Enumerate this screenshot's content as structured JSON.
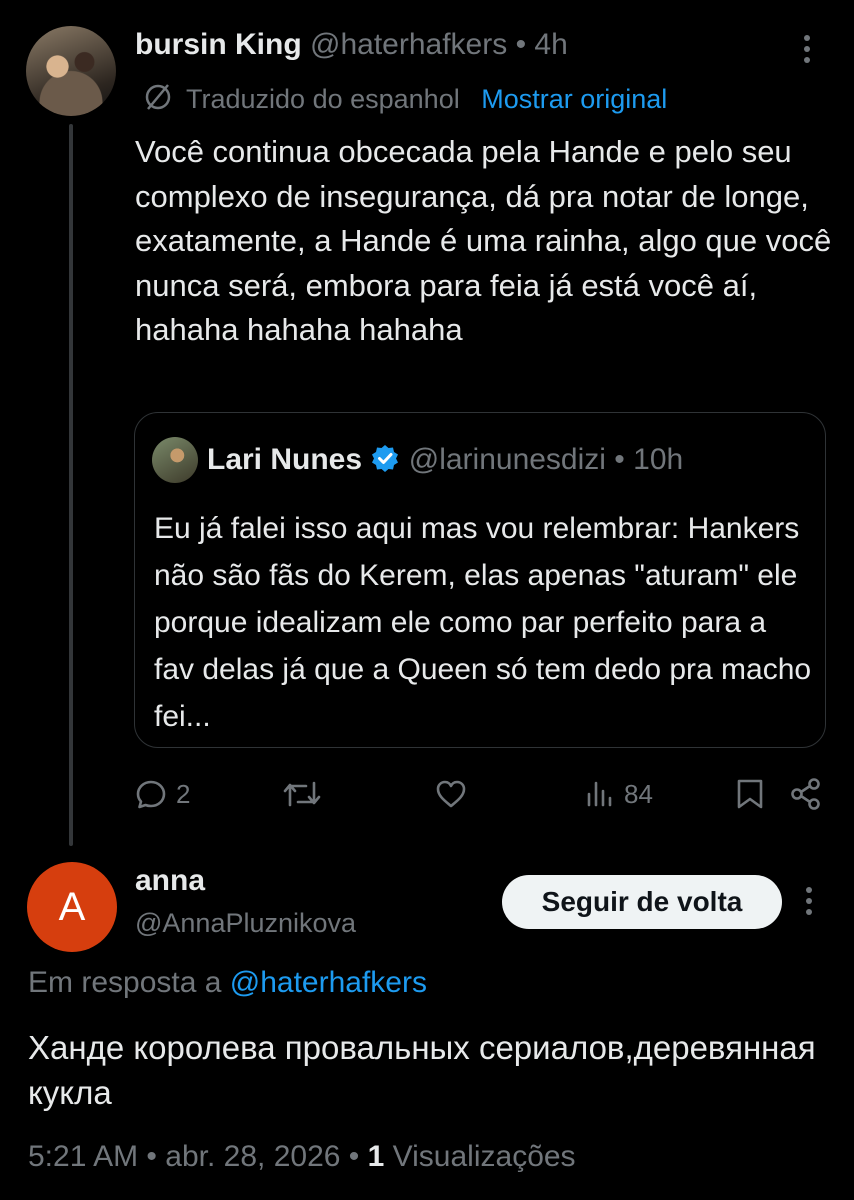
{
  "tweet": {
    "display_name": "bursin King",
    "handle": "@haterhafkers",
    "sep": "•",
    "time": "4h",
    "translate_label": "Traduzido do espanhol",
    "show_original": "Mostrar original",
    "text": "Você continua obcecada pela Hande e pelo seu complexo de insegurança, dá pra notar de longe, exatamente, a Hande é uma rainha, algo que você nunca será, embora para feia já está você aí, hahaha hahaha hahaha"
  },
  "quote": {
    "display_name": "Lari Nunes",
    "handle": "@larinunesdizi",
    "sep": "•",
    "time": "10h",
    "text": "Eu já falei isso aqui mas vou relembrar: Hankers não são fãs do Kerem, elas apenas \"aturam\" ele porque idealizam ele como par perfeito para a fav delas já que a Queen só tem dedo pra macho fei..."
  },
  "actions": {
    "reply_count": "2",
    "views_count": "84"
  },
  "reply": {
    "avatar_letter": "A",
    "display_name": "anna",
    "handle": "@AnnaPluznikova",
    "follow_label": "Seguir de volta",
    "reply_prefix": "Em resposta a",
    "reply_to": "@haterhafkers",
    "text": "Ханде королева провальных сериалов,деревянная кукла",
    "time": "5:21 AM",
    "sep": "•",
    "date": "abr. 28, 2026",
    "views": "1",
    "views_label": "Visualizações"
  },
  "colors": {
    "background": "#000000",
    "text": "#e7e9ea",
    "muted": "#71767b",
    "accent": "#1d9bf0",
    "avatar_anna": "#d63e0e"
  },
  "icons": [
    "more-icon",
    "translate-icon",
    "verified-icon",
    "reply-icon",
    "retweet-icon",
    "like-icon",
    "views-icon",
    "bookmark-icon",
    "share-icon"
  ]
}
